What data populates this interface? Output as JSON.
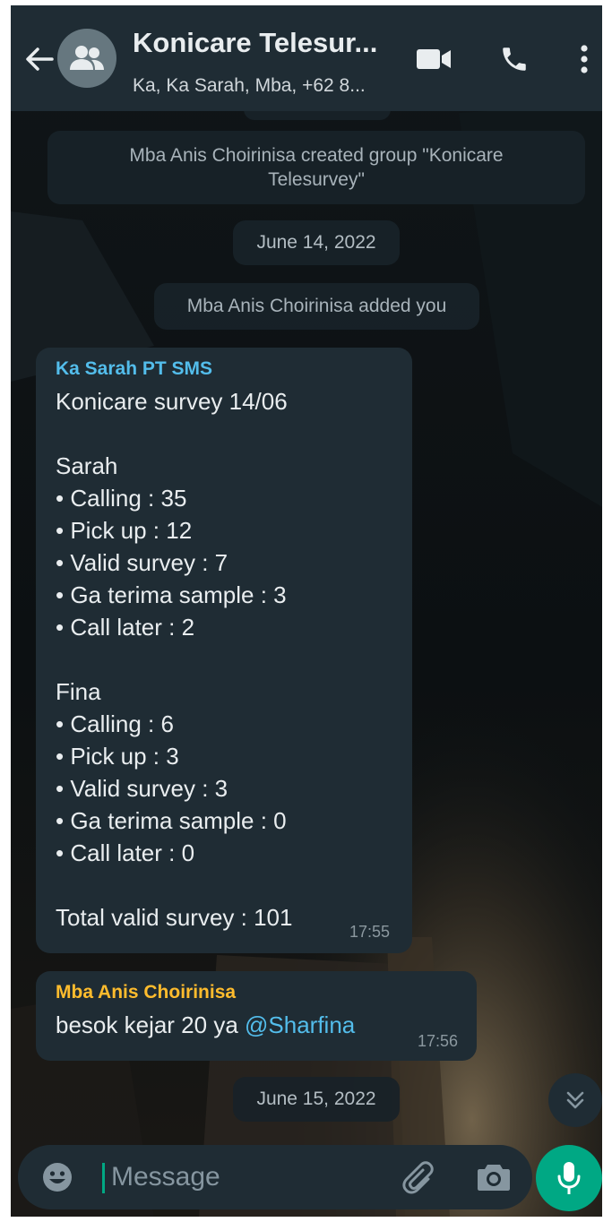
{
  "header": {
    "title": "Konicare Telesur...",
    "subtitle": "Ka, Ka Sarah, Mba, +62 8..."
  },
  "icons": {
    "back": "arrow-left-icon",
    "avatar": "group-icon",
    "video": "video-call-icon",
    "voice": "phone-icon",
    "menu": "more-vertical-icon",
    "scroll": "double-chevron-down-icon",
    "emoji": "emoji-icon",
    "attach": "paperclip-icon",
    "camera": "camera-icon",
    "mic": "microphone-icon"
  },
  "chat": {
    "system_created": "Mba Anis Choirinisa created group \"Konicare Telesurvey\"",
    "date1": "June 14, 2022",
    "system_added": "Mba Anis Choirinisa added you",
    "message1": {
      "sender": "Ka Sarah PT SMS",
      "lines": [
        "Konicare survey 14/06",
        "",
        "Sarah",
        "• Calling : 35",
        "• Pick up : 12",
        "• Valid survey : 7",
        "• Ga terima sample : 3",
        "• Call later : 2",
        "",
        "Fina",
        "• Calling : 6",
        "• Pick up : 3",
        "• Valid survey : 3",
        "• Ga terima sample : 0",
        "• Call later : 0",
        "",
        "Total valid survey : 101"
      ],
      "time": "17:55"
    },
    "message2": {
      "sender": "Mba Anis Choirinisa",
      "text": "besok kejar 20 ya ",
      "mention": "@Sharfina",
      "time": "17:56"
    },
    "date2": "June 15, 2022"
  },
  "input": {
    "placeholder": "Message"
  },
  "colors": {
    "header_bg": "#1f2c34",
    "bubble_bg": "#1f2c34",
    "accent": "#00a884",
    "sender1": "#53bdeb",
    "sender2": "#ffbc2d",
    "mention": "#53bdeb"
  }
}
